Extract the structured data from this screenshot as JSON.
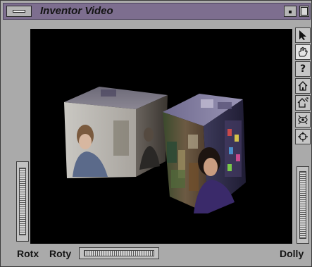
{
  "window": {
    "title": "Inventor Video"
  },
  "toolbar": {
    "tools": [
      {
        "icon": "arrow-pointer-icon",
        "active": false
      },
      {
        "icon": "hand-icon",
        "active": true
      },
      {
        "icon": "question-icon",
        "label": "?",
        "active": false
      },
      {
        "icon": "home-icon",
        "active": false
      },
      {
        "icon": "set-home-icon",
        "active": false
      },
      {
        "icon": "view-all-icon",
        "active": false
      },
      {
        "icon": "seek-icon",
        "active": false
      }
    ]
  },
  "labels": {
    "rotx": "Rotx",
    "roty": "Roty",
    "dolly": "Dolly"
  },
  "colors": {
    "title_bar": "#7d6e8f",
    "chrome": "#aaaaaa",
    "viewport": "#000000"
  }
}
